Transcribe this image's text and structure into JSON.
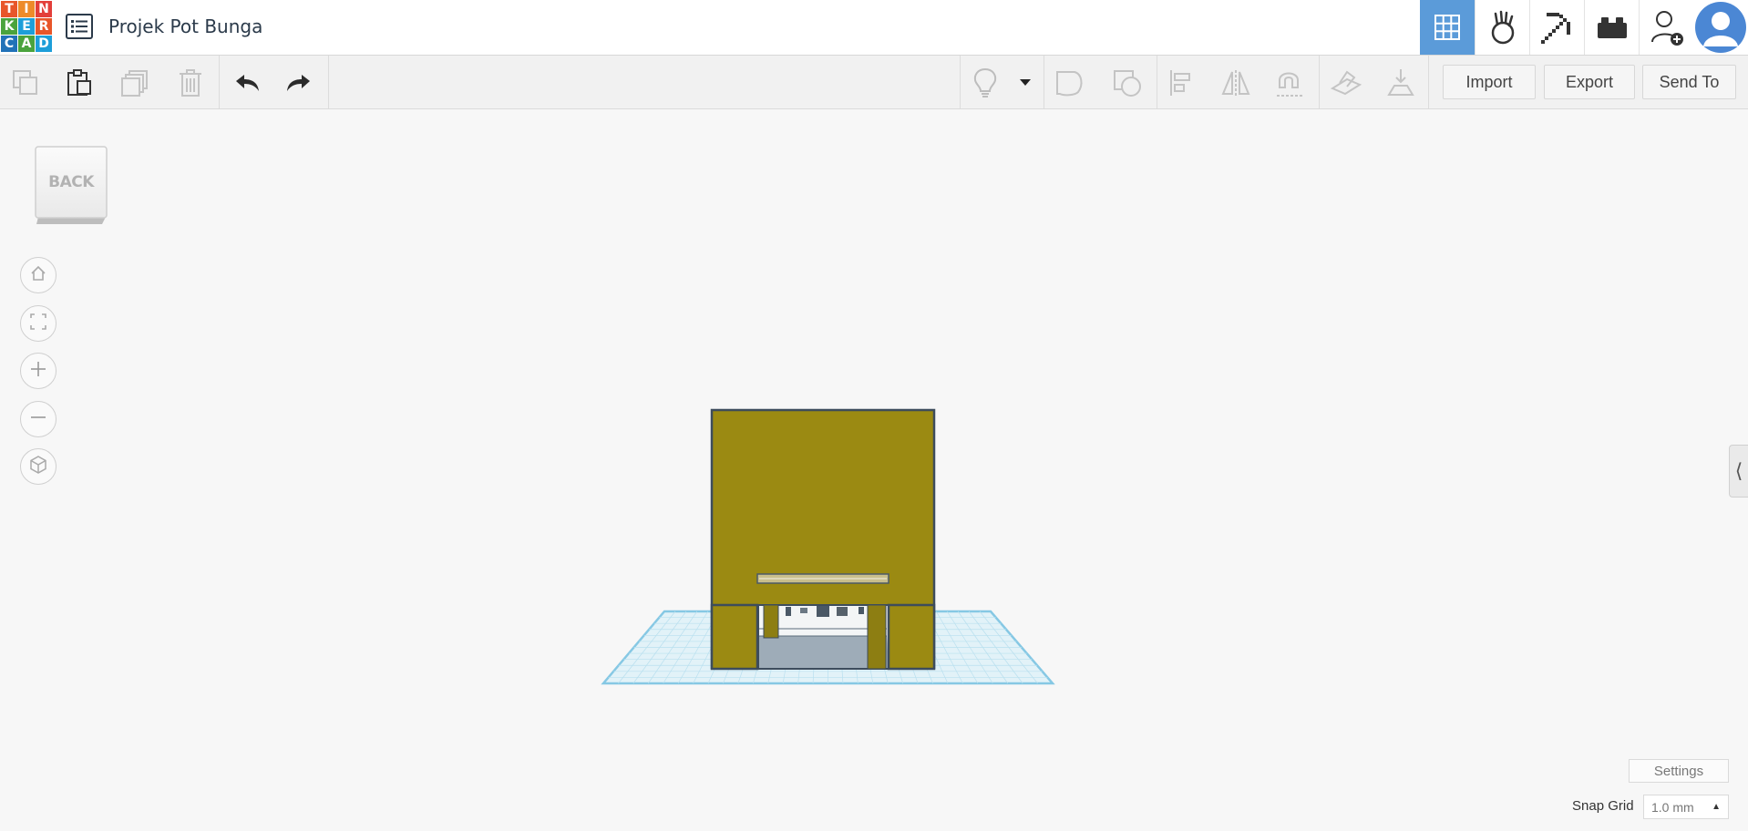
{
  "app": {
    "logo_letters": [
      "T",
      "I",
      "N",
      "K",
      "E",
      "R",
      "C",
      "A",
      "D"
    ],
    "logo_colors": [
      "#e8562a",
      "#ed8b2a",
      "#e33f3a",
      "#4aa33d",
      "#1d9ed9",
      "#e8562a",
      "#2172b8",
      "#4aa33d",
      "#1d9ed9"
    ],
    "project_title": "Projek Pot Bunga"
  },
  "topbar_right": {
    "items": [
      {
        "name": "3d-design-view-icon",
        "active": true
      },
      {
        "name": "circuits-view-icon",
        "active": false
      },
      {
        "name": "blocks-pickaxe-icon",
        "active": false
      },
      {
        "name": "bricks-view-icon",
        "active": false
      },
      {
        "name": "invite-user-icon",
        "active": false
      },
      {
        "name": "avatar",
        "active": false
      }
    ],
    "accent_color": "#5b9bd9"
  },
  "toolbar": {
    "left_icons": [
      "copy-icon",
      "paste-icon",
      "duplicate-icon",
      "delete-icon",
      "undo-icon",
      "redo-icon"
    ],
    "right_icons": [
      "light-bulb-icon",
      "dropdown-arrow-icon",
      "group-icon",
      "ungroup-icon",
      "align-icon",
      "mirror-icon",
      "cruise-magnet-icon",
      "workplane-icon",
      "ruler-drop-icon"
    ],
    "import_label": "Import",
    "export_label": "Export",
    "send_to_label": "Send To"
  },
  "view_cube": {
    "face_label": "BACK"
  },
  "nav_controls": [
    "home-view-icon",
    "fit-all-icon",
    "zoom-in-icon",
    "zoom-out-icon",
    "ortho-perspective-icon"
  ],
  "scene": {
    "object_color": "#9b8a12",
    "object_outline": "#3b4a5a",
    "workplane_color": "#dff1f7",
    "workplane_line": "#8fcde6"
  },
  "footer": {
    "settings_label": "Settings",
    "snap_grid_label": "Snap Grid",
    "snap_grid_value": "1.0 mm"
  }
}
